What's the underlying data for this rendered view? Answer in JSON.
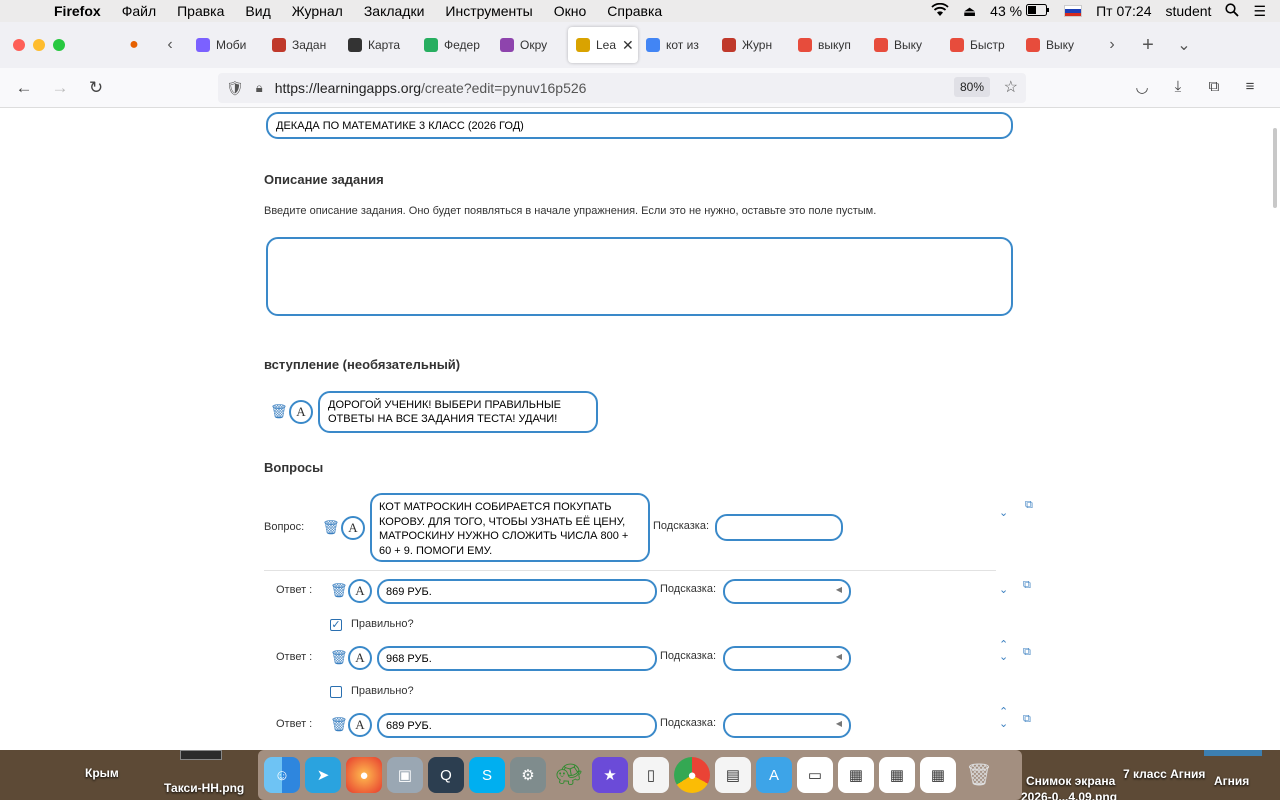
{
  "menubar": {
    "items": [
      "Firefox",
      "Файл",
      "Правка",
      "Вид",
      "Журнал",
      "Закладки",
      "Инструменты",
      "Окно",
      "Справка"
    ],
    "battery": "43 %",
    "clock": "Пт 07:24",
    "user": "student"
  },
  "tabs": [
    {
      "label": "Моби",
      "color": "#7b61ff"
    },
    {
      "label": "Задан",
      "color": "#c0392b"
    },
    {
      "label": "Карта",
      "color": "#333333"
    },
    {
      "label": "Федер",
      "color": "#27ae60"
    },
    {
      "label": "Окру",
      "color": "#8e44ad"
    },
    {
      "label": "Lea",
      "color": "#d9a300",
      "active": true
    },
    {
      "label": "кот из",
      "color": "#4285f4"
    },
    {
      "label": "Журн",
      "color": "#c0392b"
    },
    {
      "label": "выкуп",
      "color": "#e74c3c"
    },
    {
      "label": "Выку",
      "color": "#e74c3c"
    },
    {
      "label": "Быстр",
      "color": "#e74c3c"
    },
    {
      "label": "Выку",
      "color": "#e74c3c"
    }
  ],
  "address": {
    "url_host": "https://learningapps.org",
    "url_path": "/create?edit=pynuv16p526",
    "zoom": "80%"
  },
  "form": {
    "title_value": "ДЕКАДА ПО МАТЕМАТИКЕ 3 КЛАСС (2026 ГОД)",
    "description_heading": "Описание задания",
    "description_help": "Введите описание задания. Оно будет появляться в начале упражнения. Если это не нужно, оставьте это поле пустым.",
    "description_value": "",
    "intro_heading": "вступление (необязательный)",
    "intro_value": "ДОРОГОЙ УЧЕНИК! ВЫБЕРИ ПРАВИЛЬНЫЕ ОТВЕТЫ НА ВСЕ ЗАДАНИЯ ТЕСТА! УДАЧИ!",
    "questions_heading": "Вопросы",
    "question_label": "Вопрос:",
    "question_value": "КОТ МАТРОСКИН СОБИРАЕТСЯ ПОКУПАТЬ КОРОВУ. ДЛЯ ТОГО, ЧТОБЫ УЗНАТЬ ЕЁ ЦЕНУ, МАТРОСКИНУ НУЖНО СЛОЖИТЬ ЧИСЛА 800 + 60 + 9. ПОМОГИ ЕМУ.",
    "hint_label": "Подсказка:",
    "answer_label": "Ответ :",
    "correct_label": "Правильно?",
    "answers": [
      {
        "value": "869 РУБ.",
        "correct": true
      },
      {
        "value": "968 РУБ.",
        "correct": false
      },
      {
        "value": "689 РУБ.",
        "correct": false
      }
    ]
  },
  "desktop": {
    "left_labels": [
      "Крым",
      "Такси-НН.png"
    ],
    "right_labels": [
      "Снимок экрана",
      "2026-0...4.09.png",
      "7 класс Агния",
      "Агния"
    ]
  }
}
